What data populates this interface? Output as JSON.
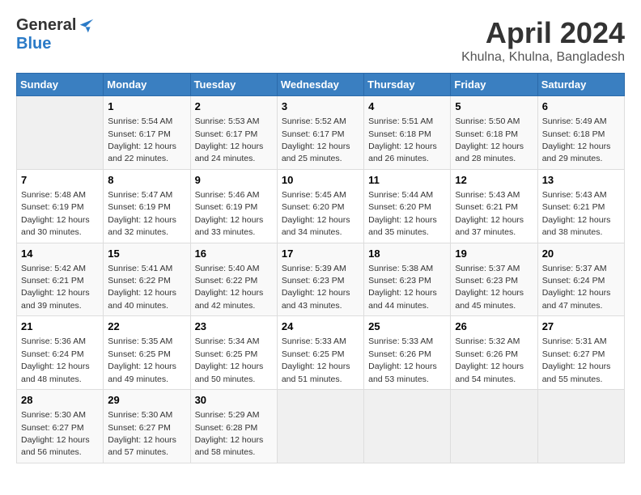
{
  "header": {
    "logo_general": "General",
    "logo_blue": "Blue",
    "month_year": "April 2024",
    "location": "Khulna, Khulna, Bangladesh"
  },
  "days_of_week": [
    "Sunday",
    "Monday",
    "Tuesday",
    "Wednesday",
    "Thursday",
    "Friday",
    "Saturday"
  ],
  "weeks": [
    [
      {
        "day": "",
        "sunrise": "",
        "sunset": "",
        "daylight": "",
        "empty": true
      },
      {
        "day": "1",
        "sunrise": "Sunrise: 5:54 AM",
        "sunset": "Sunset: 6:17 PM",
        "daylight": "Daylight: 12 hours and 22 minutes."
      },
      {
        "day": "2",
        "sunrise": "Sunrise: 5:53 AM",
        "sunset": "Sunset: 6:17 PM",
        "daylight": "Daylight: 12 hours and 24 minutes."
      },
      {
        "day": "3",
        "sunrise": "Sunrise: 5:52 AM",
        "sunset": "Sunset: 6:17 PM",
        "daylight": "Daylight: 12 hours and 25 minutes."
      },
      {
        "day": "4",
        "sunrise": "Sunrise: 5:51 AM",
        "sunset": "Sunset: 6:18 PM",
        "daylight": "Daylight: 12 hours and 26 minutes."
      },
      {
        "day": "5",
        "sunrise": "Sunrise: 5:50 AM",
        "sunset": "Sunset: 6:18 PM",
        "daylight": "Daylight: 12 hours and 28 minutes."
      },
      {
        "day": "6",
        "sunrise": "Sunrise: 5:49 AM",
        "sunset": "Sunset: 6:18 PM",
        "daylight": "Daylight: 12 hours and 29 minutes."
      }
    ],
    [
      {
        "day": "7",
        "sunrise": "Sunrise: 5:48 AM",
        "sunset": "Sunset: 6:19 PM",
        "daylight": "Daylight: 12 hours and 30 minutes."
      },
      {
        "day": "8",
        "sunrise": "Sunrise: 5:47 AM",
        "sunset": "Sunset: 6:19 PM",
        "daylight": "Daylight: 12 hours and 32 minutes."
      },
      {
        "day": "9",
        "sunrise": "Sunrise: 5:46 AM",
        "sunset": "Sunset: 6:19 PM",
        "daylight": "Daylight: 12 hours and 33 minutes."
      },
      {
        "day": "10",
        "sunrise": "Sunrise: 5:45 AM",
        "sunset": "Sunset: 6:20 PM",
        "daylight": "Daylight: 12 hours and 34 minutes."
      },
      {
        "day": "11",
        "sunrise": "Sunrise: 5:44 AM",
        "sunset": "Sunset: 6:20 PM",
        "daylight": "Daylight: 12 hours and 35 minutes."
      },
      {
        "day": "12",
        "sunrise": "Sunrise: 5:43 AM",
        "sunset": "Sunset: 6:21 PM",
        "daylight": "Daylight: 12 hours and 37 minutes."
      },
      {
        "day": "13",
        "sunrise": "Sunrise: 5:43 AM",
        "sunset": "Sunset: 6:21 PM",
        "daylight": "Daylight: 12 hours and 38 minutes."
      }
    ],
    [
      {
        "day": "14",
        "sunrise": "Sunrise: 5:42 AM",
        "sunset": "Sunset: 6:21 PM",
        "daylight": "Daylight: 12 hours and 39 minutes."
      },
      {
        "day": "15",
        "sunrise": "Sunrise: 5:41 AM",
        "sunset": "Sunset: 6:22 PM",
        "daylight": "Daylight: 12 hours and 40 minutes."
      },
      {
        "day": "16",
        "sunrise": "Sunrise: 5:40 AM",
        "sunset": "Sunset: 6:22 PM",
        "daylight": "Daylight: 12 hours and 42 minutes."
      },
      {
        "day": "17",
        "sunrise": "Sunrise: 5:39 AM",
        "sunset": "Sunset: 6:23 PM",
        "daylight": "Daylight: 12 hours and 43 minutes."
      },
      {
        "day": "18",
        "sunrise": "Sunrise: 5:38 AM",
        "sunset": "Sunset: 6:23 PM",
        "daylight": "Daylight: 12 hours and 44 minutes."
      },
      {
        "day": "19",
        "sunrise": "Sunrise: 5:37 AM",
        "sunset": "Sunset: 6:23 PM",
        "daylight": "Daylight: 12 hours and 45 minutes."
      },
      {
        "day": "20",
        "sunrise": "Sunrise: 5:37 AM",
        "sunset": "Sunset: 6:24 PM",
        "daylight": "Daylight: 12 hours and 47 minutes."
      }
    ],
    [
      {
        "day": "21",
        "sunrise": "Sunrise: 5:36 AM",
        "sunset": "Sunset: 6:24 PM",
        "daylight": "Daylight: 12 hours and 48 minutes."
      },
      {
        "day": "22",
        "sunrise": "Sunrise: 5:35 AM",
        "sunset": "Sunset: 6:25 PM",
        "daylight": "Daylight: 12 hours and 49 minutes."
      },
      {
        "day": "23",
        "sunrise": "Sunrise: 5:34 AM",
        "sunset": "Sunset: 6:25 PM",
        "daylight": "Daylight: 12 hours and 50 minutes."
      },
      {
        "day": "24",
        "sunrise": "Sunrise: 5:33 AM",
        "sunset": "Sunset: 6:25 PM",
        "daylight": "Daylight: 12 hours and 51 minutes."
      },
      {
        "day": "25",
        "sunrise": "Sunrise: 5:33 AM",
        "sunset": "Sunset: 6:26 PM",
        "daylight": "Daylight: 12 hours and 53 minutes."
      },
      {
        "day": "26",
        "sunrise": "Sunrise: 5:32 AM",
        "sunset": "Sunset: 6:26 PM",
        "daylight": "Daylight: 12 hours and 54 minutes."
      },
      {
        "day": "27",
        "sunrise": "Sunrise: 5:31 AM",
        "sunset": "Sunset: 6:27 PM",
        "daylight": "Daylight: 12 hours and 55 minutes."
      }
    ],
    [
      {
        "day": "28",
        "sunrise": "Sunrise: 5:30 AM",
        "sunset": "Sunset: 6:27 PM",
        "daylight": "Daylight: 12 hours and 56 minutes."
      },
      {
        "day": "29",
        "sunrise": "Sunrise: 5:30 AM",
        "sunset": "Sunset: 6:27 PM",
        "daylight": "Daylight: 12 hours and 57 minutes."
      },
      {
        "day": "30",
        "sunrise": "Sunrise: 5:29 AM",
        "sunset": "Sunset: 6:28 PM",
        "daylight": "Daylight: 12 hours and 58 minutes."
      },
      {
        "day": "",
        "sunrise": "",
        "sunset": "",
        "daylight": "",
        "empty": true
      },
      {
        "day": "",
        "sunrise": "",
        "sunset": "",
        "daylight": "",
        "empty": true
      },
      {
        "day": "",
        "sunrise": "",
        "sunset": "",
        "daylight": "",
        "empty": true
      },
      {
        "day": "",
        "sunrise": "",
        "sunset": "",
        "daylight": "",
        "empty": true
      }
    ]
  ]
}
